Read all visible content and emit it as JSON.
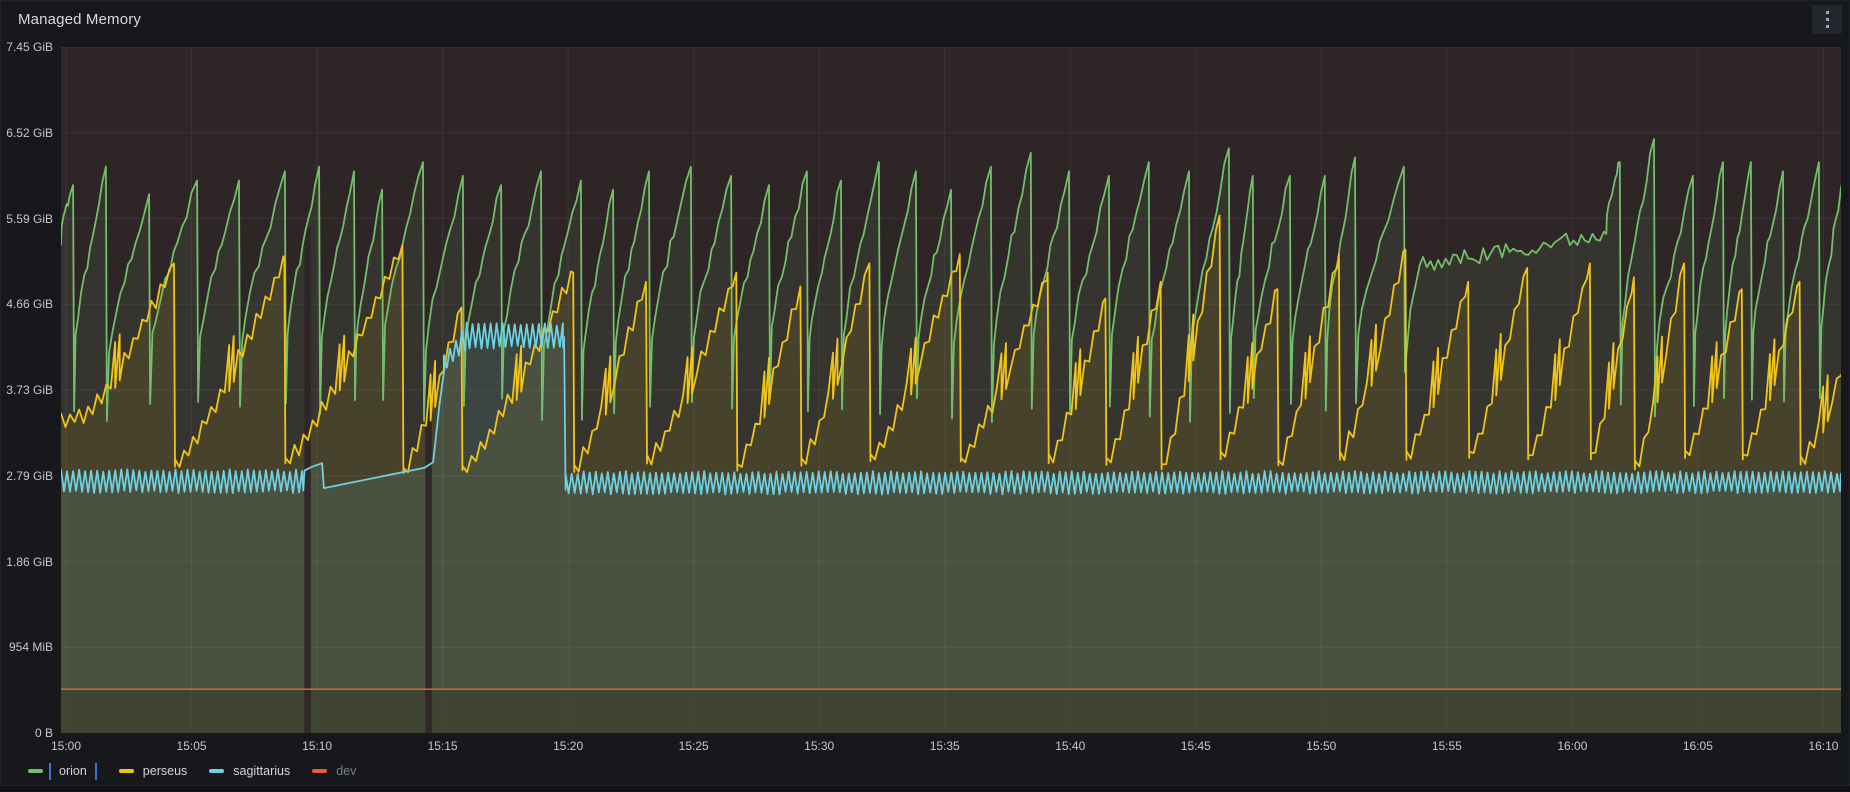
{
  "panel": {
    "title": "Managed Memory"
  },
  "legend": {
    "focused": "orion",
    "focus_color": "#3a6fd8"
  },
  "chart_data": {
    "type": "line",
    "title": "Managed Memory",
    "unit": "bytes (GiB)",
    "noise_seed": 11,
    "x_axis": {
      "t_min": -0.2,
      "t_max": 70.7,
      "tick_interval_min": 5,
      "ticks": [
        {
          "label": "15:00",
          "t": 0
        },
        {
          "label": "15:05",
          "t": 5
        },
        {
          "label": "15:10",
          "t": 10
        },
        {
          "label": "15:15",
          "t": 15
        },
        {
          "label": "15:20",
          "t": 20
        },
        {
          "label": "15:25",
          "t": 25
        },
        {
          "label": "15:30",
          "t": 30
        },
        {
          "label": "15:35",
          "t": 35
        },
        {
          "label": "15:40",
          "t": 40
        },
        {
          "label": "15:45",
          "t": 45
        },
        {
          "label": "15:50",
          "t": 50
        },
        {
          "label": "15:55",
          "t": 55
        },
        {
          "label": "16:00",
          "t": 60
        },
        {
          "label": "16:05",
          "t": 65
        },
        {
          "label": "16:10",
          "t": 70
        }
      ]
    },
    "y_axis": {
      "max_gib": 7.45,
      "ticks": [
        {
          "label": "0 B",
          "gib": 0
        },
        {
          "label": "954 MiB",
          "gib": 0.93125
        },
        {
          "label": "1.86 GiB",
          "gib": 1.8625
        },
        {
          "label": "2.79 GiB",
          "gib": 2.79375
        },
        {
          "label": "3.73 GiB",
          "gib": 3.725
        },
        {
          "label": "4.66 GiB",
          "gib": 4.65625
        },
        {
          "label": "5.59 GiB",
          "gib": 5.5875
        },
        {
          "label": "6.52 GiB",
          "gib": 6.51875
        },
        {
          "label": "7.45 GiB",
          "gib": 7.45
        }
      ],
      "grid": true
    },
    "series": [
      {
        "name": "orion",
        "color": "#73bf69",
        "fill_opacity": 0.1,
        "type": "sawtooth",
        "trough_range": [
          3.35,
          3.65
        ],
        "start_value": 5.3,
        "rise_profile": [
          [
            0,
            0
          ],
          [
            0.05,
            0.3
          ],
          [
            0.12,
            0.38
          ],
          [
            0.22,
            0.48
          ],
          [
            0.32,
            0.55
          ],
          [
            0.42,
            0.6
          ],
          [
            0.5,
            0.68
          ],
          [
            0.58,
            0.72
          ],
          [
            0.68,
            0.78
          ],
          [
            0.78,
            0.85
          ],
          [
            0.88,
            0.93
          ],
          [
            1,
            1
          ]
        ],
        "cycles_pre_plateau": [
          [
            0.28,
            5.95
          ],
          [
            1.59,
            6.15
          ],
          [
            3.31,
            5.85
          ],
          [
            5.22,
            6.0
          ],
          [
            6.89,
            6.0
          ],
          [
            8.72,
            6.1
          ],
          [
            10.08,
            6.15
          ],
          [
            11.47,
            6.1
          ],
          [
            12.59,
            5.9
          ],
          [
            14.22,
            6.2
          ],
          [
            15.81,
            6.05
          ],
          [
            17.33,
            5.95
          ],
          [
            18.92,
            6.1
          ],
          [
            20.51,
            6.0
          ],
          [
            21.79,
            5.9
          ],
          [
            23.22,
            6.1
          ],
          [
            24.89,
            6.15
          ],
          [
            26.49,
            6.05
          ],
          [
            28.0,
            5.95
          ],
          [
            29.51,
            6.1
          ],
          [
            30.87,
            6.0
          ],
          [
            32.38,
            6.2
          ],
          [
            33.85,
            6.1
          ],
          [
            35.25,
            5.9
          ],
          [
            36.84,
            6.15
          ],
          [
            38.43,
            6.3
          ],
          [
            39.95,
            6.1
          ],
          [
            41.54,
            6.05
          ],
          [
            43.13,
            6.2
          ],
          [
            44.73,
            6.1
          ],
          [
            46.32,
            6.35
          ],
          [
            47.27,
            6.05
          ],
          [
            48.75,
            6.05
          ],
          [
            50.14,
            6.05
          ],
          [
            51.34,
            6.25
          ],
          [
            53.29,
            6.15
          ]
        ],
        "plateau": {
          "t0": 53.9,
          "t1": 61.35,
          "v0": 5.08,
          "v1": 5.42,
          "noise": 0.09,
          "step": 0.15,
          "pre_ramp": [
            [
              53.33,
              3.92
            ],
            [
              53.55,
              4.6
            ],
            [
              53.9,
              5.05
            ]
          ]
        },
        "cycles_post_plateau": [
          [
            61.89,
            6.2
          ],
          [
            63.25,
            6.45
          ],
          [
            64.8,
            6.05
          ],
          [
            66.0,
            6.2
          ],
          [
            67.11,
            6.2
          ],
          [
            68.39,
            6.1
          ],
          [
            69.82,
            6.2
          ],
          [
            70.94,
            6.3
          ]
        ]
      },
      {
        "name": "perseus",
        "color": "#f0c419",
        "fill_opacity": 0.1,
        "type": "ramp",
        "trough_range": [
          2.82,
          3.0
        ],
        "start_value": 3.42,
        "first_flat_until": 0.7,
        "tooth": {
          "step_min": 0.18,
          "amp": 0.07,
          "jitter": 0.06
        },
        "mid_spike": {
          "at": 0.5,
          "up": 0.35,
          "down": 0.5
        },
        "cycles": [
          [
            4.3,
            5.1
          ],
          [
            8.7,
            5.15
          ],
          [
            13.4,
            5.3
          ],
          [
            15.75,
            4.62
          ],
          [
            20.2,
            5.0
          ],
          [
            23.1,
            4.9
          ],
          [
            26.7,
            5.0
          ],
          [
            29.25,
            4.85
          ],
          [
            32.0,
            5.1
          ],
          [
            35.6,
            5.2
          ],
          [
            39.1,
            5.0
          ],
          [
            41.4,
            4.72
          ],
          [
            43.6,
            4.9
          ],
          [
            45.95,
            5.62
          ],
          [
            48.25,
            4.82
          ],
          [
            50.7,
            5.2
          ],
          [
            53.35,
            5.25
          ],
          [
            55.85,
            4.9
          ],
          [
            58.2,
            5.05
          ],
          [
            60.7,
            5.1
          ],
          [
            62.45,
            4.95
          ],
          [
            64.45,
            5.1
          ],
          [
            66.75,
            4.82
          ],
          [
            69.05,
            4.9
          ],
          [
            71.2,
            4.3
          ]
        ]
      },
      {
        "name": "sagittarius",
        "color": "#6ed0e0",
        "fill_opacity": 0.11,
        "type": "segments",
        "segments": [
          {
            "type": "zigzag",
            "t0": -0.2,
            "t1": 9.45,
            "lo": [
              2.62,
              2.62
            ],
            "hi": [
              2.85,
              2.85
            ],
            "period": 0.24
          },
          {
            "type": "path",
            "points": [
              [
                9.5,
                2.85
              ],
              [
                9.78,
                2.89
              ],
              [
                10.2,
                2.93
              ],
              [
                10.27,
                2.66
              ],
              [
                14.28,
                2.88
              ],
              [
                14.62,
                2.94
              ],
              [
                14.88,
                3.58
              ],
              [
                15.05,
                3.92
              ]
            ]
          },
          {
            "type": "zigzag",
            "t0": 15.05,
            "t1": 15.95,
            "lo": [
              3.92,
              4.18
            ],
            "hi": [
              4.1,
              4.42
            ],
            "period": 0.24
          },
          {
            "type": "zigzag",
            "t0": 15.95,
            "t1": 19.8,
            "lo": [
              4.18,
              4.2
            ],
            "hi": [
              4.44,
              4.44
            ],
            "period": 0.24
          },
          {
            "type": "path",
            "points": [
              [
                19.84,
                4.3
              ],
              [
                19.9,
                2.64
              ]
            ]
          },
          {
            "type": "zigzag",
            "t0": 19.9,
            "t1": 70.7,
            "lo": [
              2.6,
              2.62
            ],
            "hi": [
              2.83,
              2.83
            ],
            "period": 0.24
          }
        ]
      },
      {
        "name": "dev",
        "color": "#e0632d",
        "fill_opacity": 0.07,
        "type": "flat",
        "value_gib": 0.475,
        "dimmed": true
      }
    ],
    "data_gaps": [
      {
        "t": 9.62,
        "width_min": 0.26,
        "top_gib": 5.5
      },
      {
        "t": 14.44,
        "width_min": 0.26,
        "top_gib": 3.78
      }
    ],
    "plot_background": "#2e2527",
    "grid_color": "rgba(204,204,220,0.09)",
    "below_dev_shade": "rgba(18,36,24,0.30)"
  }
}
